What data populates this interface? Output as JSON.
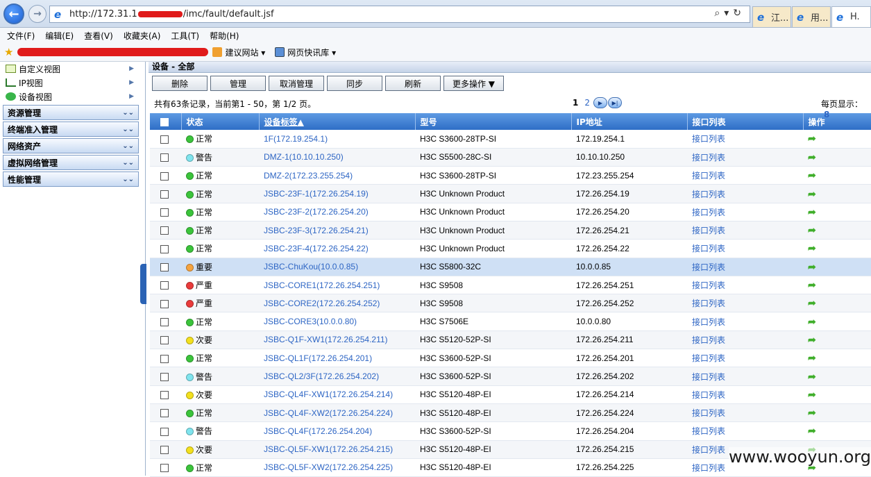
{
  "browser": {
    "url_prefix": "http://172.31.1",
    "url_suffix": "/imc/fault/default.jsf",
    "tabs": [
      {
        "label": "江..."
      },
      {
        "label": "用..."
      },
      {
        "label": "H."
      }
    ],
    "menu": [
      "文件(F)",
      "编辑(E)",
      "查看(V)",
      "收藏夹(A)",
      "工具(T)",
      "帮助(H)"
    ],
    "favorites": [
      {
        "label": "建议网站 ▾",
        "icon": "suggested-sites-icon"
      },
      {
        "label": "网页快讯库 ▾",
        "icon": "web-slice-icon"
      }
    ]
  },
  "sidebar": {
    "tree": [
      {
        "label": "自定义视图",
        "icon": "folder-icon"
      },
      {
        "label": "IP视图",
        "icon": "network-tree-icon"
      },
      {
        "label": "设备视图",
        "icon": "device-view-icon"
      }
    ],
    "sections": [
      "资源管理",
      "终端准入管理",
      "网络资产",
      "虚拟网络管理",
      "性能管理"
    ]
  },
  "main": {
    "title": "设备 - 全部",
    "toolbar": [
      "删除",
      "管理",
      "取消管理",
      "同步",
      "刷新",
      "更多操作 ▼"
    ],
    "pager": {
      "summary": "共有63条记录，当前第1 - 50，第 1/2 页。",
      "current_page": "1",
      "next_page": "2",
      "per_page_label": "每页显示：",
      "per_page_value": "8"
    },
    "columns": [
      "",
      "状态",
      "设备标签▲",
      "型号",
      "IP地址",
      "接口列表",
      "操作"
    ],
    "status_colors": {
      "正常": "#3bc43b",
      "警告": "#7fe4ee",
      "重要": "#f5a33f",
      "严重": "#ea3b3b",
      "次要": "#f3e01e"
    },
    "rows": [
      {
        "status": "正常",
        "label": "1F(172.19.254.1)",
        "model": "H3C S3600-28TP-SI",
        "ip": "172.19.254.1",
        "iface": "接口列表"
      },
      {
        "status": "警告",
        "label": "DMZ-1(10.10.10.250)",
        "model": "H3C S5500-28C-SI",
        "ip": "10.10.10.250",
        "iface": "接口列表"
      },
      {
        "status": "正常",
        "label": "DMZ-2(172.23.255.254)",
        "model": "H3C S3600-28TP-SI",
        "ip": "172.23.255.254",
        "iface": "接口列表"
      },
      {
        "status": "正常",
        "label": "JSBC-23F-1(172.26.254.19)",
        "model": "H3C Unknown Product",
        "ip": "172.26.254.19",
        "iface": "接口列表"
      },
      {
        "status": "正常",
        "label": "JSBC-23F-2(172.26.254.20)",
        "model": "H3C Unknown Product",
        "ip": "172.26.254.20",
        "iface": "接口列表"
      },
      {
        "status": "正常",
        "label": "JSBC-23F-3(172.26.254.21)",
        "model": "H3C Unknown Product",
        "ip": "172.26.254.21",
        "iface": "接口列表"
      },
      {
        "status": "正常",
        "label": "JSBC-23F-4(172.26.254.22)",
        "model": "H3C Unknown Product",
        "ip": "172.26.254.22",
        "iface": "接口列表"
      },
      {
        "status": "重要",
        "label": "JSBC-ChuKou(10.0.0.85)",
        "model": "H3C S5800-32C",
        "ip": "10.0.0.85",
        "iface": "接口列表"
      },
      {
        "status": "严重",
        "label": "JSBC-CORE1(172.26.254.251)",
        "model": "H3C S9508",
        "ip": "172.26.254.251",
        "iface": "接口列表"
      },
      {
        "status": "严重",
        "label": "JSBC-CORE2(172.26.254.252)",
        "model": "H3C S9508",
        "ip": "172.26.254.252",
        "iface": "接口列表"
      },
      {
        "status": "正常",
        "label": "JSBC-CORE3(10.0.0.80)",
        "model": "H3C S7506E",
        "ip": "10.0.0.80",
        "iface": "接口列表"
      },
      {
        "status": "次要",
        "label": "JSBC-Q1F-XW1(172.26.254.211)",
        "model": "H3C S5120-52P-SI",
        "ip": "172.26.254.211",
        "iface": "接口列表"
      },
      {
        "status": "正常",
        "label": "JSBC-QL1F(172.26.254.201)",
        "model": "H3C S3600-52P-SI",
        "ip": "172.26.254.201",
        "iface": "接口列表"
      },
      {
        "status": "警告",
        "label": "JSBC-QL2/3F(172.26.254.202)",
        "model": "H3C S3600-52P-SI",
        "ip": "172.26.254.202",
        "iface": "接口列表"
      },
      {
        "status": "次要",
        "label": "JSBC-QL4F-XW1(172.26.254.214)",
        "model": "H3C S5120-48P-EI",
        "ip": "172.26.254.214",
        "iface": "接口列表"
      },
      {
        "status": "正常",
        "label": "JSBC-QL4F-XW2(172.26.254.224)",
        "model": "H3C S5120-48P-EI",
        "ip": "172.26.254.224",
        "iface": "接口列表"
      },
      {
        "status": "警告",
        "label": "JSBC-QL4F(172.26.254.204)",
        "model": "H3C S3600-52P-SI",
        "ip": "172.26.254.204",
        "iface": "接口列表"
      },
      {
        "status": "次要",
        "label": "JSBC-QL5F-XW1(172.26.254.215)",
        "model": "H3C S5120-48P-EI",
        "ip": "172.26.254.215",
        "iface": "接口列表"
      },
      {
        "status": "正常",
        "label": "JSBC-QL5F-XW2(172.26.254.225)",
        "model": "H3C S5120-48P-EI",
        "ip": "172.26.254.225",
        "iface": "接口列表"
      }
    ],
    "highlighted_row": 7
  },
  "watermark": "www.wooyun.org"
}
